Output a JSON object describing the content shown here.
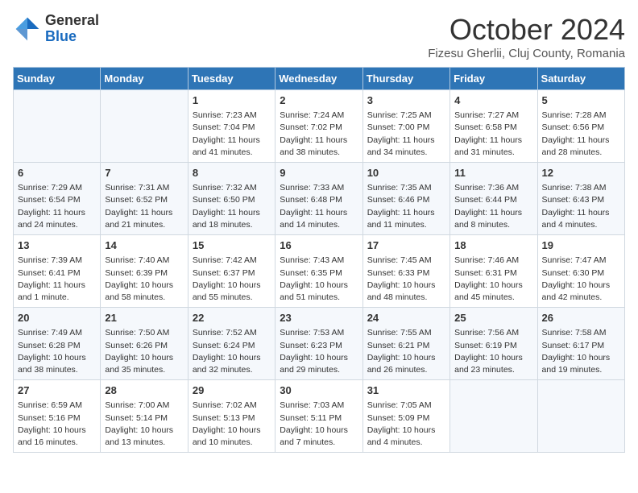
{
  "header": {
    "logo_general": "General",
    "logo_blue": "Blue",
    "title": "October 2024",
    "subtitle": "Fizesu Gherlii, Cluj County, Romania"
  },
  "days": [
    "Sunday",
    "Monday",
    "Tuesday",
    "Wednesday",
    "Thursday",
    "Friday",
    "Saturday"
  ],
  "weeks": [
    [
      {
        "day": "",
        "content": ""
      },
      {
        "day": "",
        "content": ""
      },
      {
        "day": "1",
        "content": "Sunrise: 7:23 AM\nSunset: 7:04 PM\nDaylight: 11 hours and 41 minutes."
      },
      {
        "day": "2",
        "content": "Sunrise: 7:24 AM\nSunset: 7:02 PM\nDaylight: 11 hours and 38 minutes."
      },
      {
        "day": "3",
        "content": "Sunrise: 7:25 AM\nSunset: 7:00 PM\nDaylight: 11 hours and 34 minutes."
      },
      {
        "day": "4",
        "content": "Sunrise: 7:27 AM\nSunset: 6:58 PM\nDaylight: 11 hours and 31 minutes."
      },
      {
        "day": "5",
        "content": "Sunrise: 7:28 AM\nSunset: 6:56 PM\nDaylight: 11 hours and 28 minutes."
      }
    ],
    [
      {
        "day": "6",
        "content": "Sunrise: 7:29 AM\nSunset: 6:54 PM\nDaylight: 11 hours and 24 minutes."
      },
      {
        "day": "7",
        "content": "Sunrise: 7:31 AM\nSunset: 6:52 PM\nDaylight: 11 hours and 21 minutes."
      },
      {
        "day": "8",
        "content": "Sunrise: 7:32 AM\nSunset: 6:50 PM\nDaylight: 11 hours and 18 minutes."
      },
      {
        "day": "9",
        "content": "Sunrise: 7:33 AM\nSunset: 6:48 PM\nDaylight: 11 hours and 14 minutes."
      },
      {
        "day": "10",
        "content": "Sunrise: 7:35 AM\nSunset: 6:46 PM\nDaylight: 11 hours and 11 minutes."
      },
      {
        "day": "11",
        "content": "Sunrise: 7:36 AM\nSunset: 6:44 PM\nDaylight: 11 hours and 8 minutes."
      },
      {
        "day": "12",
        "content": "Sunrise: 7:38 AM\nSunset: 6:43 PM\nDaylight: 11 hours and 4 minutes."
      }
    ],
    [
      {
        "day": "13",
        "content": "Sunrise: 7:39 AM\nSunset: 6:41 PM\nDaylight: 11 hours and 1 minute."
      },
      {
        "day": "14",
        "content": "Sunrise: 7:40 AM\nSunset: 6:39 PM\nDaylight: 10 hours and 58 minutes."
      },
      {
        "day": "15",
        "content": "Sunrise: 7:42 AM\nSunset: 6:37 PM\nDaylight: 10 hours and 55 minutes."
      },
      {
        "day": "16",
        "content": "Sunrise: 7:43 AM\nSunset: 6:35 PM\nDaylight: 10 hours and 51 minutes."
      },
      {
        "day": "17",
        "content": "Sunrise: 7:45 AM\nSunset: 6:33 PM\nDaylight: 10 hours and 48 minutes."
      },
      {
        "day": "18",
        "content": "Sunrise: 7:46 AM\nSunset: 6:31 PM\nDaylight: 10 hours and 45 minutes."
      },
      {
        "day": "19",
        "content": "Sunrise: 7:47 AM\nSunset: 6:30 PM\nDaylight: 10 hours and 42 minutes."
      }
    ],
    [
      {
        "day": "20",
        "content": "Sunrise: 7:49 AM\nSunset: 6:28 PM\nDaylight: 10 hours and 38 minutes."
      },
      {
        "day": "21",
        "content": "Sunrise: 7:50 AM\nSunset: 6:26 PM\nDaylight: 10 hours and 35 minutes."
      },
      {
        "day": "22",
        "content": "Sunrise: 7:52 AM\nSunset: 6:24 PM\nDaylight: 10 hours and 32 minutes."
      },
      {
        "day": "23",
        "content": "Sunrise: 7:53 AM\nSunset: 6:23 PM\nDaylight: 10 hours and 29 minutes."
      },
      {
        "day": "24",
        "content": "Sunrise: 7:55 AM\nSunset: 6:21 PM\nDaylight: 10 hours and 26 minutes."
      },
      {
        "day": "25",
        "content": "Sunrise: 7:56 AM\nSunset: 6:19 PM\nDaylight: 10 hours and 23 minutes."
      },
      {
        "day": "26",
        "content": "Sunrise: 7:58 AM\nSunset: 6:17 PM\nDaylight: 10 hours and 19 minutes."
      }
    ],
    [
      {
        "day": "27",
        "content": "Sunrise: 6:59 AM\nSunset: 5:16 PM\nDaylight: 10 hours and 16 minutes."
      },
      {
        "day": "28",
        "content": "Sunrise: 7:00 AM\nSunset: 5:14 PM\nDaylight: 10 hours and 13 minutes."
      },
      {
        "day": "29",
        "content": "Sunrise: 7:02 AM\nSunset: 5:13 PM\nDaylight: 10 hours and 10 minutes."
      },
      {
        "day": "30",
        "content": "Sunrise: 7:03 AM\nSunset: 5:11 PM\nDaylight: 10 hours and 7 minutes."
      },
      {
        "day": "31",
        "content": "Sunrise: 7:05 AM\nSunset: 5:09 PM\nDaylight: 10 hours and 4 minutes."
      },
      {
        "day": "",
        "content": ""
      },
      {
        "day": "",
        "content": ""
      }
    ]
  ]
}
